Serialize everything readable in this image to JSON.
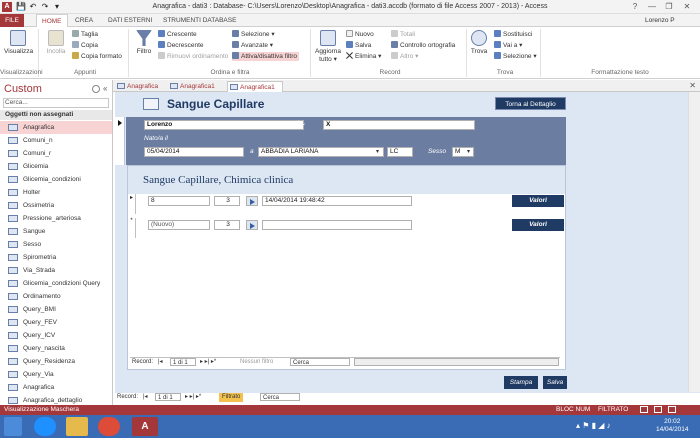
{
  "window": {
    "title": "Anagrafica - dati3 : Database- C:\\Users\\Lorenzo\\Desktop\\Anagrafica - dati3.accdb (formato di file Access 2007 - 2013) - Access",
    "user": "Lorenzo P",
    "controls": [
      "?",
      "—",
      "❐",
      "✕"
    ]
  },
  "quick_access": [
    "💾",
    "↶",
    "↷",
    "▾"
  ],
  "ribbon_tabs": [
    "FILE",
    "HOME",
    "CREA",
    "DATI ESTERNI",
    "STRUMENTI DATABASE"
  ],
  "ribbon": {
    "visualizza": "Visualizza",
    "incolla": "Incolla",
    "taglia": "Taglia",
    "copia": "Copia",
    "copia_formato": "Copia formato",
    "filtro": "Filtro",
    "crescente": "Crescente",
    "decrescente": "Decrescente",
    "rimuovi_ordinamento": "Rimuovi ordinamento",
    "selezione": "Selezione ▾",
    "avanzate": "Avanzate ▾",
    "attiva_filtro": "Attiva/disattiva filtro",
    "aggiorna": "Aggiorna tutto ▾",
    "nuovo": "Nuovo",
    "salva": "Salva",
    "elimina": "Elimina ▾",
    "totali": "Totali",
    "controllo_ortografia": "Controllo ortografia",
    "altro": "Altro ▾",
    "trova": "Trova",
    "sostituisci": "Sostituisci",
    "vai_a": "Vai a ▾",
    "selezione2": "Selezione ▾",
    "groups": [
      "Visualizzazioni",
      "Appunti",
      "Ordina e filtra",
      "Record",
      "Trova",
      "Formattazione testo"
    ]
  },
  "nav": {
    "title": "Custom",
    "search_value": "Cerca...",
    "group": "Oggetti non assegnati",
    "items": [
      "Anagrafica",
      "Comuni_n",
      "Comuni_r",
      "Glicemia",
      "Glicemia_condizioni",
      "Holter",
      "Ossimetria",
      "Pressione_arteriosa",
      "Sangue",
      "Sesso",
      "Spirometria",
      "Via_Strada",
      "Glicemia_condizioni Query",
      "Ordinamento",
      "Query_BMI",
      "Query_FEV",
      "Query_ICV",
      "Query_nascita",
      "Query_Residenza",
      "Query_Via",
      "Anagrafica",
      "Anagrafica_dettaglio"
    ]
  },
  "doc_tabs": [
    "Anagrafica",
    "Anagrafica1",
    "Anagrafica1"
  ],
  "form": {
    "title": "Sangue Capillare",
    "btn_dettaglio": "Torna al Dettaglio",
    "nome": "Lorenzo",
    "cognome": "X",
    "nato_label": "Nato/a il",
    "data_nascita": "05/04/2014",
    "a_label": "a",
    "comune": "ABBADIA LARIANA",
    "provincia": "LC",
    "sesso_label": "Sesso",
    "sesso": "M",
    "sub_title": "Sangue Capillare, Chimica clinica",
    "rows": [
      {
        "id": "8",
        "num": "3",
        "datetime": "14/04/2014 19:48:42",
        "btn": "Valori"
      },
      {
        "id": "(Nuovo)",
        "num": "3",
        "datetime": "",
        "btn": "Valori"
      }
    ],
    "subnav": {
      "label": "Record:",
      "pos": "1 di 1",
      "filter": "Nessun filtro",
      "search": "Cerca"
    },
    "stampa": "Stampa",
    "salva": "Salva"
  },
  "main_nav": {
    "label": "Record:",
    "pos": "1 di 1",
    "filter": "Filtrato",
    "search": "Cerca"
  },
  "status": {
    "left": "Visualizzazione Maschera",
    "bloc": "BLOC NUM",
    "filtrato": "FILTRATO"
  },
  "clock": {
    "time": "20:02",
    "date": "14/04/2014"
  },
  "colors": {
    "accent": "#a4373a",
    "form_bg": "#dde7f4",
    "header_band": "#6b7da0",
    "button": "#1f3a63"
  }
}
